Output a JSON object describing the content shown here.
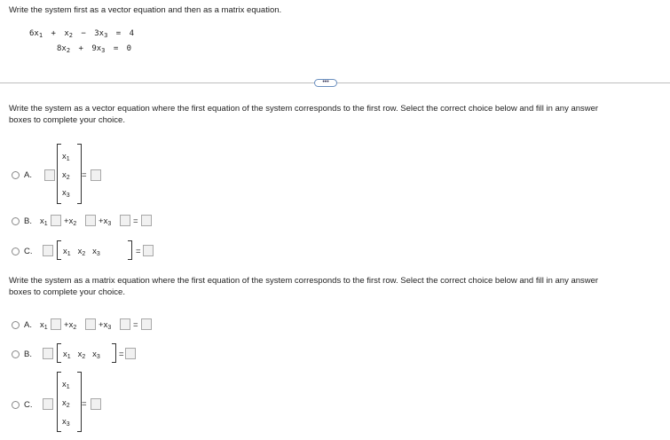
{
  "instruction": "Write the system first as a vector equation and then as a matrix equation.",
  "system": {
    "eq1": {
      "t1_coef": "6x",
      "t1_sub": "1",
      "plus1": "+",
      "t2": "x",
      "t2_sub": "2",
      "minus": "−",
      "t3_coef": "3x",
      "t3_sub": "3",
      "equals": "=",
      "rhs": "4"
    },
    "eq2": {
      "t2_coef": "8x",
      "t2_sub": "2",
      "plus": "+",
      "t3_coef": "9x",
      "t3_sub": "3",
      "equals": "=",
      "rhs": "0"
    }
  },
  "more_button": "•••",
  "part1": {
    "prompt_line1": "Write the system as a vector equation where the first equation of the system corresponds to the first row. Select the correct choice below and fill in any answer",
    "prompt_line2": "boxes to complete your choice.",
    "option_a": {
      "label": "A.",
      "x1": "x",
      "x2": "x",
      "x3": "x",
      "s1": "1",
      "s2": "2",
      "s3": "3",
      "equals": "="
    },
    "option_b": {
      "label": "B.",
      "x1": "x",
      "x2": "x",
      "x3": "x",
      "s1": "1",
      "s2": "2",
      "s3": "3",
      "plus1": "+",
      "plus2": "+",
      "equals": "="
    },
    "option_c": {
      "label": "C.",
      "x1": "x",
      "x2": "x",
      "x3": "x",
      "s1": "1",
      "s2": "2",
      "s3": "3",
      "equals": "="
    }
  },
  "part2": {
    "prompt_line1": "Write the system as a matrix equation where the first equation of the system corresponds to the first row. Select the correct choice below and fill in any answer",
    "prompt_line2": "boxes to complete your choice.",
    "option_a": {
      "label": "A.",
      "x1": "x",
      "x2": "x",
      "x3": "x",
      "s1": "1",
      "s2": "2",
      "s3": "3",
      "plus1": "+",
      "plus2": "+",
      "equals": "="
    },
    "option_b": {
      "label": "B.",
      "x1": "x",
      "x2": "x",
      "x3": "x",
      "s1": "1",
      "s2": "2",
      "s3": "3",
      "equals": "="
    },
    "option_c": {
      "label": "C.",
      "x1": "x",
      "x2": "x",
      "x3": "x",
      "s1": "1",
      "s2": "2",
      "s3": "3",
      "equals": "="
    }
  }
}
